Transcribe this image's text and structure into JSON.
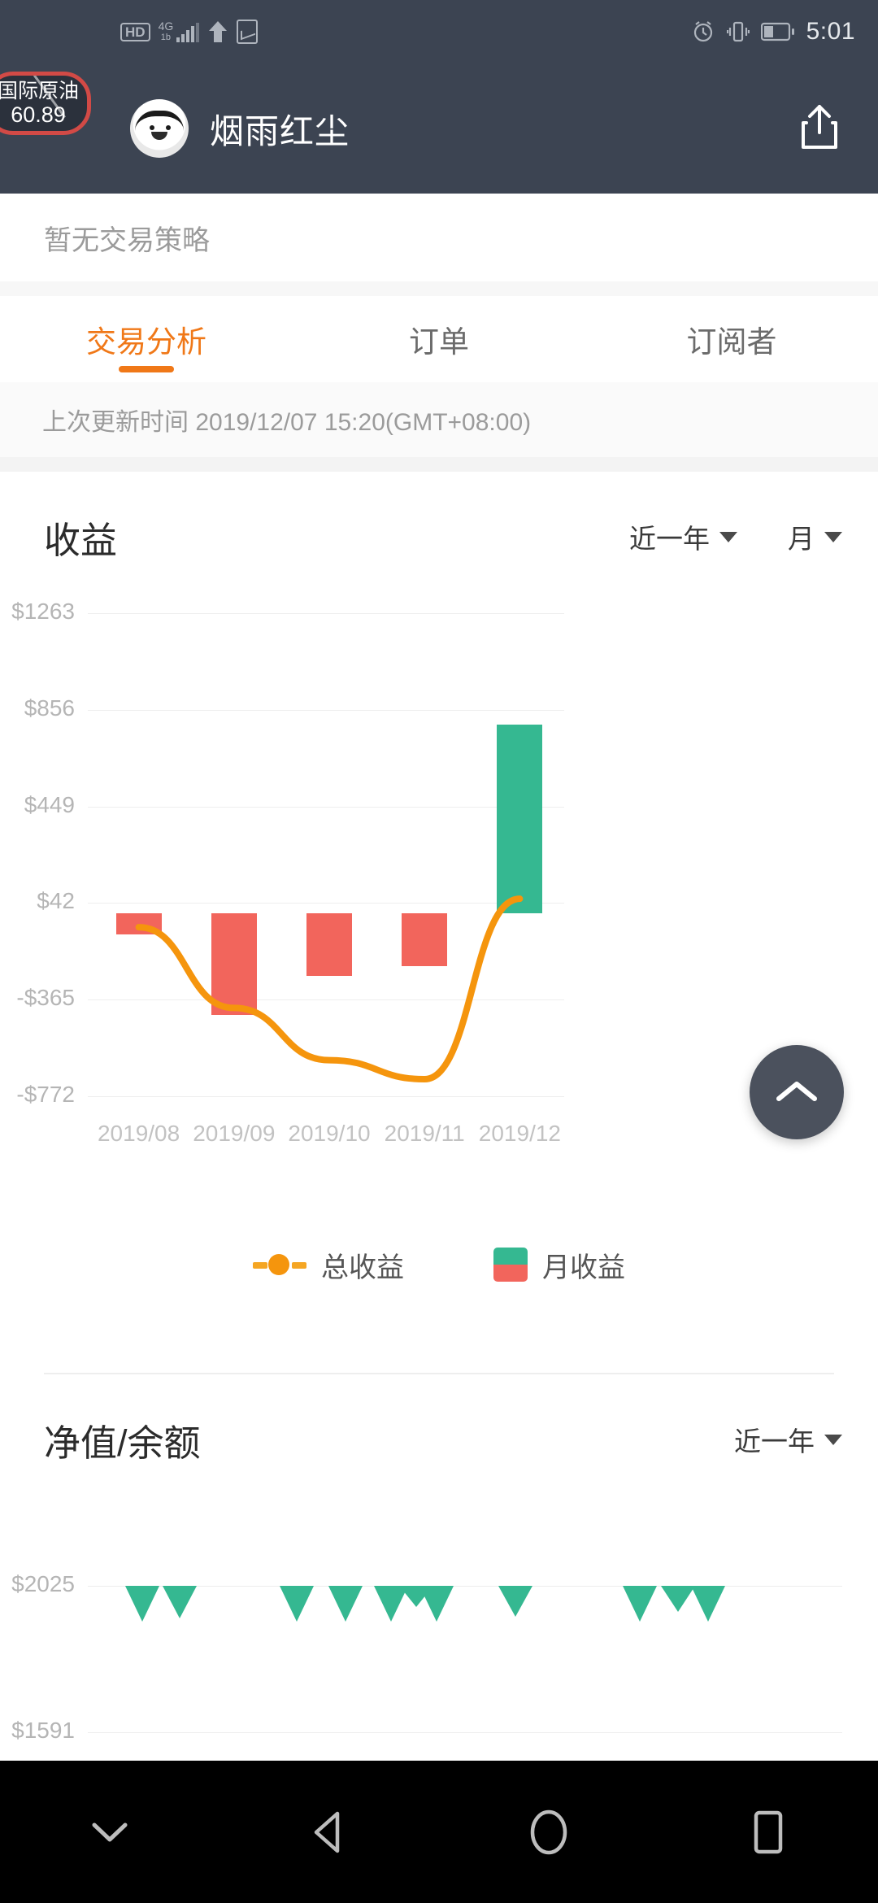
{
  "status_bar": {
    "hd_label": "HD",
    "network_type": "4G",
    "network_sub": "1b",
    "icons": [
      "hd-icon",
      "signal-icon",
      "upload-arrow-icon",
      "stock-app-icon",
      "alarm-icon",
      "vibrate-icon",
      "battery-icon"
    ],
    "time": "5:01"
  },
  "floating_widget": {
    "name": "国际原油",
    "value": "60.89",
    "border_color": "#d24a46",
    "bg_color": "#2b313c"
  },
  "app_bar": {
    "title": "烟雨红尘",
    "share_icon": "share-icon",
    "bg_color": "#3c4452"
  },
  "strategy_notice": "暂无交易策略",
  "tabs": [
    {
      "label": "交易分析",
      "active": true
    },
    {
      "label": "订单",
      "active": false
    },
    {
      "label": "订阅者",
      "active": false
    }
  ],
  "accent_color": "#f07818",
  "updated_text": "上次更新时间 2019/12/07 15:20(GMT+08:00)",
  "earnings_card": {
    "title": "收益",
    "range_dropdown": "近一年",
    "period_dropdown": "月",
    "legend": [
      {
        "label": "总收益",
        "type": "line",
        "color": "#f5950d"
      },
      {
        "label": "月收益",
        "type": "bar",
        "color_positive": "#35b891",
        "color_negative": "#f2655c"
      }
    ]
  },
  "net_card": {
    "title": "净值/余额",
    "range_dropdown": "近一年"
  },
  "fab": {
    "icon": "chevron-up-icon",
    "color": "#4b515d"
  },
  "nav_bar": {
    "items": [
      {
        "name": "hide-nav-button",
        "icon": "chevron-down-icon"
      },
      {
        "name": "back-button",
        "icon": "triangle-left-icon"
      },
      {
        "name": "home-button",
        "icon": "circle-icon"
      },
      {
        "name": "recents-button",
        "icon": "square-icon"
      }
    ]
  },
  "chart_data": [
    {
      "id": "earnings",
      "type": "bar",
      "title": "收益",
      "categories": [
        "2019/08",
        "2019/09",
        "2019/10",
        "2019/11",
        "2019/12"
      ],
      "series": [
        {
          "name": "月收益",
          "type": "bar",
          "values": [
            -90,
            -430,
            -265,
            -225,
            795
          ]
        },
        {
          "name": "总收益",
          "type": "line",
          "values": [
            -60,
            -400,
            -620,
            -700,
            60
          ]
        }
      ],
      "ytick_labels": [
        "$1263",
        "$856",
        "$449",
        "$42",
        "-$365",
        "-$772"
      ],
      "ytick_values": [
        1263,
        856,
        449,
        42,
        -365,
        -772
      ],
      "ylim": [
        -772,
        1263
      ],
      "xlabel": "",
      "ylabel": "",
      "grid": true,
      "legend_position": "bottom",
      "colors": {
        "positive_bar": "#35b891",
        "negative_bar": "#f2655c",
        "line": "#f5950d"
      }
    },
    {
      "id": "net-value",
      "type": "bar",
      "title": "净值/余额",
      "ytick_labels": [
        "$2025",
        "$1591"
      ],
      "ytick_values": [
        2025,
        1591
      ],
      "ylim": [
        1591,
        2025
      ],
      "markers": [
        {
          "x_pct": 4.5,
          "height": 44
        },
        {
          "x_pct": 9.5,
          "height": 40
        },
        {
          "x_pct": 25.0,
          "height": 44
        },
        {
          "x_pct": 31.5,
          "height": 44
        },
        {
          "x_pct": 37.5,
          "height": 44
        },
        {
          "x_pct": 40.8,
          "height": 26
        },
        {
          "x_pct": 43.5,
          "height": 44
        },
        {
          "x_pct": 54.0,
          "height": 38
        },
        {
          "x_pct": 70.5,
          "height": 44
        },
        {
          "x_pct": 75.5,
          "height": 32
        },
        {
          "x_pct": 79.5,
          "height": 44
        }
      ],
      "marker_color": "#35b891",
      "line_color": "#f5950d",
      "grid": true
    }
  ]
}
